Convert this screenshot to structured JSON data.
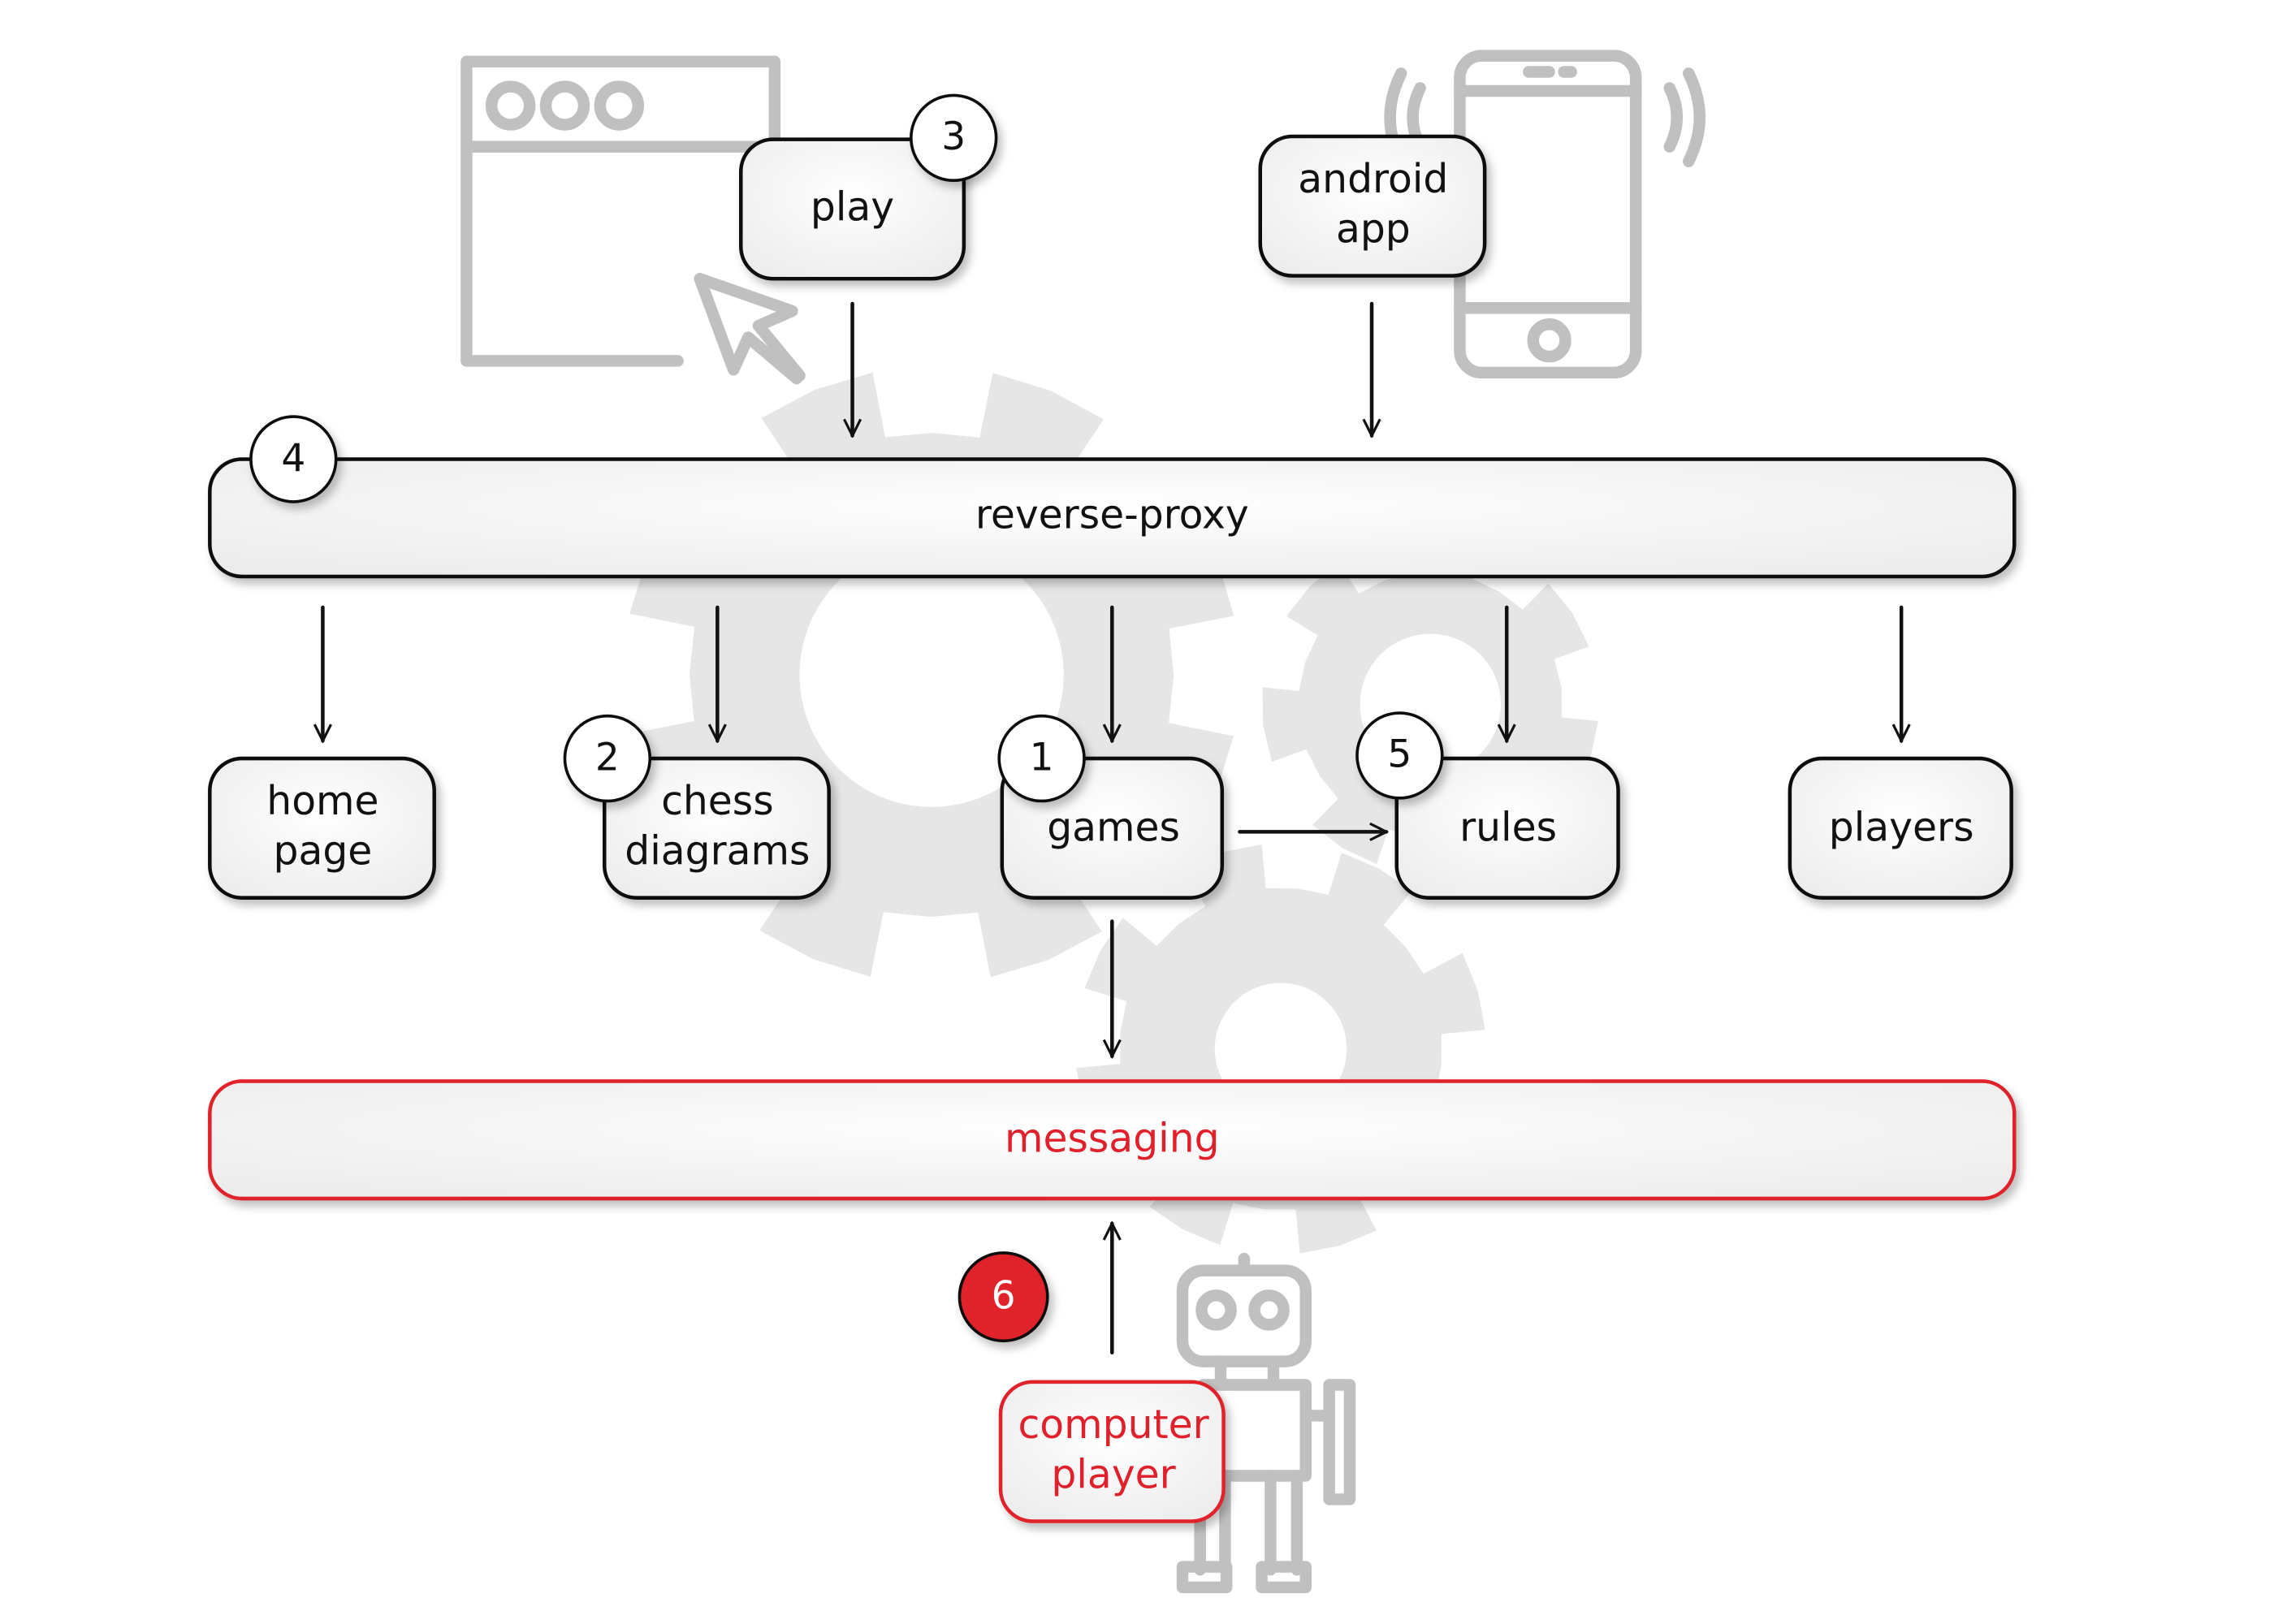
{
  "nodes": {
    "play": "play",
    "android_line1": "android",
    "android_line2": "app",
    "reverse_proxy": "reverse-proxy",
    "home_line1": "home",
    "home_line2": "page",
    "chess_line1": "chess",
    "chess_line2": "diagrams",
    "games": "games",
    "rules": "rules",
    "players": "players",
    "messaging": "messaging",
    "computer_line1": "computer",
    "computer_line2": "player"
  },
  "badges": {
    "games": "1",
    "chess": "2",
    "play": "3",
    "proxy": "4",
    "rules": "5",
    "computer": "6"
  },
  "colors": {
    "accent_red": "#e0202a",
    "icon_gray": "#c0c0c0",
    "gear_gray": "#e6e6e6",
    "box_fill": "#f4f4f4",
    "stroke": "#111111"
  },
  "icons": [
    "browser-window-icon",
    "cursor-icon",
    "smartphone-icon",
    "robot-icon",
    "gear-icon"
  ]
}
